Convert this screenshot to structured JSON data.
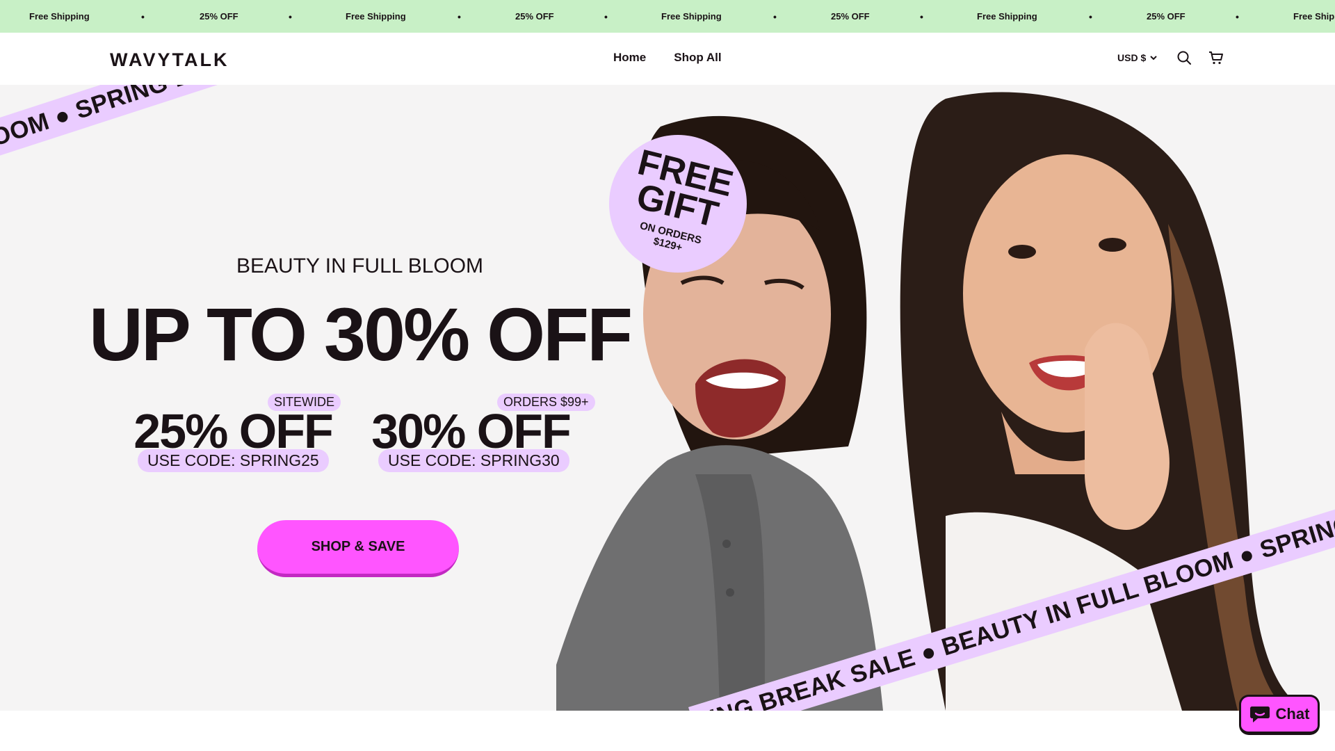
{
  "announcement": {
    "items": [
      "Free Shipping",
      "25% OFF",
      "Free Shipping",
      "25% OFF",
      "Free Shipping",
      "25% OFF",
      "Free Shipping",
      "25% OFF",
      "Free Shipp"
    ],
    "separator": "•"
  },
  "header": {
    "logo": "WAVYTALK",
    "nav": [
      "Home",
      "Shop All"
    ],
    "currency": "USD $",
    "icons": [
      "search-icon",
      "cart-icon",
      "chevron-down-icon"
    ]
  },
  "hero": {
    "ribbon_top": "LOOM  ●  SPRING BREAK SALE  ●  BEAUTY IN FULL",
    "ribbon_bottom": "RING BREAK SALE  ●  BEAUTY IN FULL BLOOM  ●  SPRING",
    "badge": {
      "line1": "FREE",
      "line2": "GIFT",
      "line3": "ON ORDERS",
      "line4": "$129+"
    },
    "subtitle": "BEAUTY IN FULL BLOOM",
    "headline": "UP TO 30% OFF",
    "offers": [
      {
        "tag": "SITEWIDE",
        "amount": "25% OFF",
        "code": "USE CODE: SPRING25"
      },
      {
        "tag": "ORDERS $99+",
        "amount": "30% OFF",
        "code": "USE CODE: SPRING30"
      }
    ],
    "cta": "SHOP & SAVE"
  },
  "chat": {
    "label": "Chat",
    "icon": "chat-bubble-icon"
  },
  "colors": {
    "announcement_bg": "#c8f0c6",
    "accent_pink": "#ff55ff",
    "lavender": "#eaccff",
    "text_dark": "#1a1216",
    "hero_bg": "#f5f4f4"
  }
}
